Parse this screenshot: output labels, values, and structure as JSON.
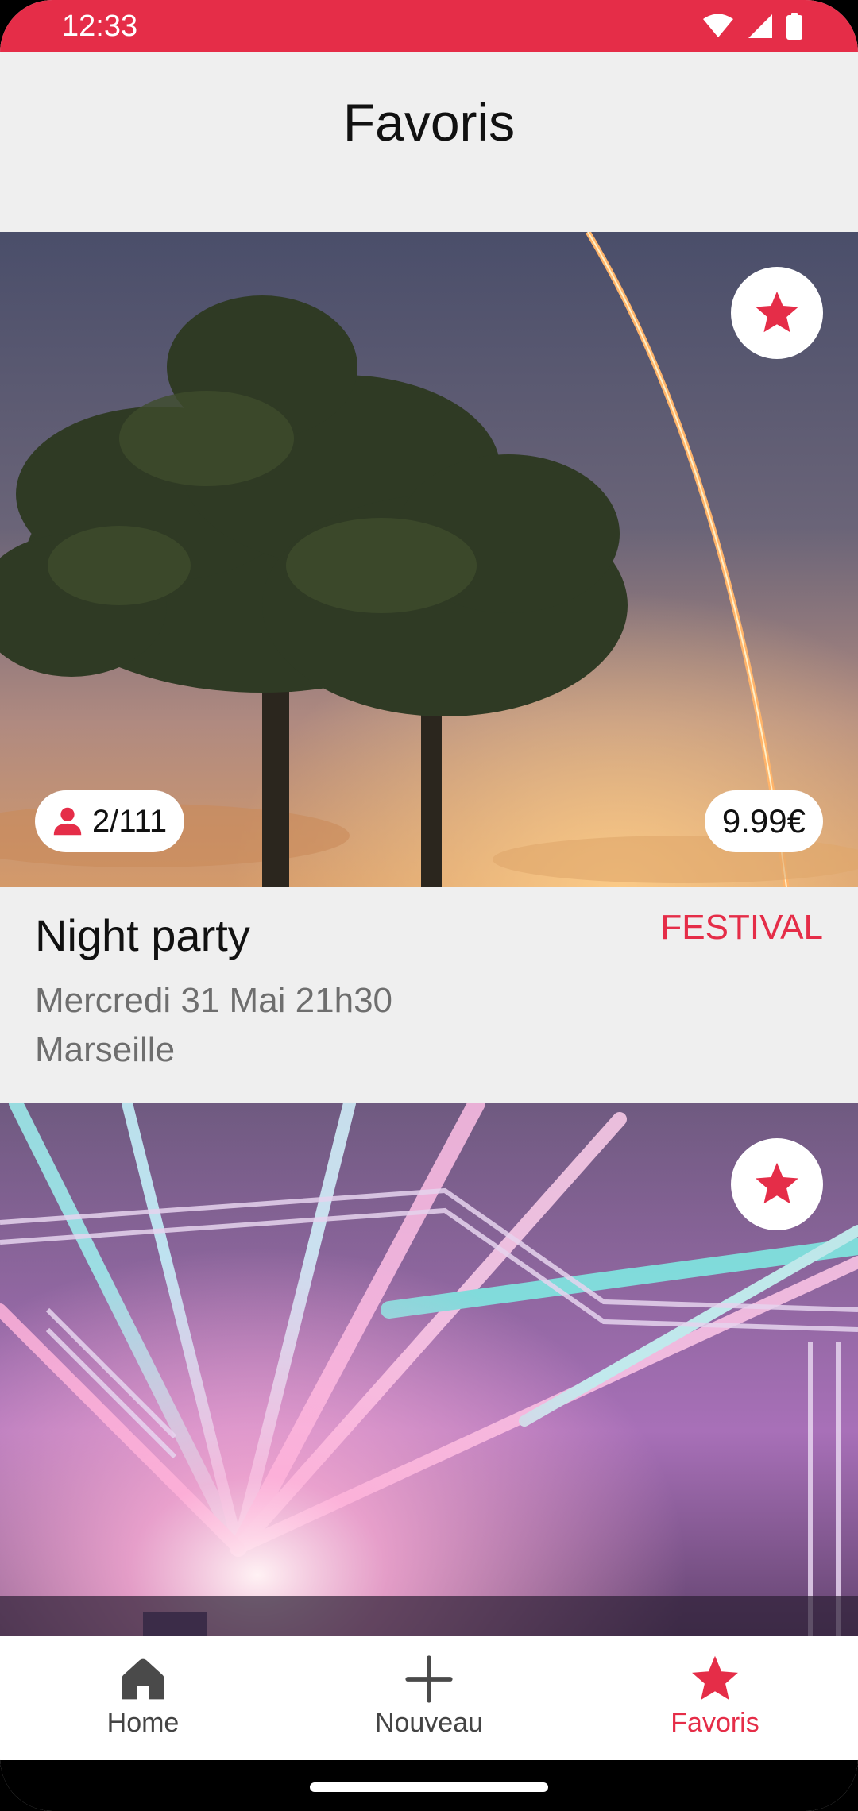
{
  "status_bar": {
    "time": "12:33",
    "icons": [
      "wifi-icon",
      "signal-icon",
      "battery-icon"
    ],
    "color": "#e52d48"
  },
  "header": {
    "title": "Favoris"
  },
  "events": [
    {
      "title": "Night party",
      "category": "FESTIVAL",
      "date": "Mercredi 31 Mai 21h30",
      "city": "Marseille",
      "attendees": "2/111",
      "price": "9.99€",
      "favorite": true
    },
    {
      "favorite": true
    }
  ],
  "bottom_nav": {
    "items": [
      {
        "label": "Home",
        "icon": "home-icon",
        "active": false
      },
      {
        "label": "Nouveau",
        "icon": "plus-icon",
        "active": false
      },
      {
        "label": "Favoris",
        "icon": "star-icon",
        "active": true
      }
    ]
  },
  "colors": {
    "accent": "#e52d48",
    "background": "#efefef",
    "secondary_text": "#6e6e6e"
  }
}
